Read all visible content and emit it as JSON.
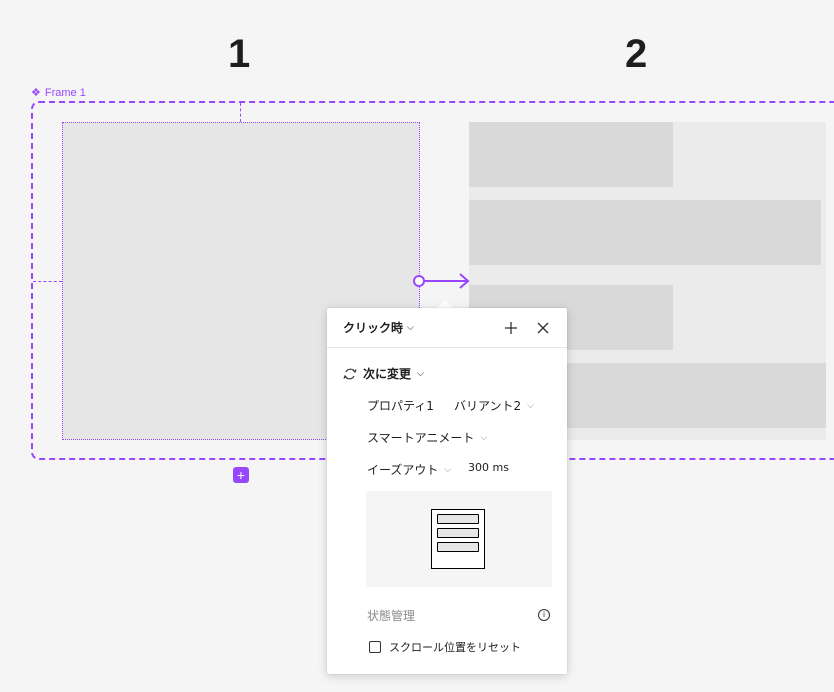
{
  "canvas": {
    "variant_numbers": [
      "1",
      "2"
    ],
    "frame_label": "Frame 1",
    "frame_icon": "component-set-icon",
    "accent_color": "#9747ff"
  },
  "interaction": {
    "trigger_label": "クリック時",
    "action_label": "次に変更",
    "property_label": "プロパティ1",
    "property_value": "バリアント2",
    "animation_label": "スマートアニメート",
    "easing_label": "イーズアウト",
    "duration_label": "300 ms",
    "state_management_label": "状態管理",
    "reset_scroll_label": "スクロール位置をリセット",
    "reset_scroll_checked": false
  }
}
